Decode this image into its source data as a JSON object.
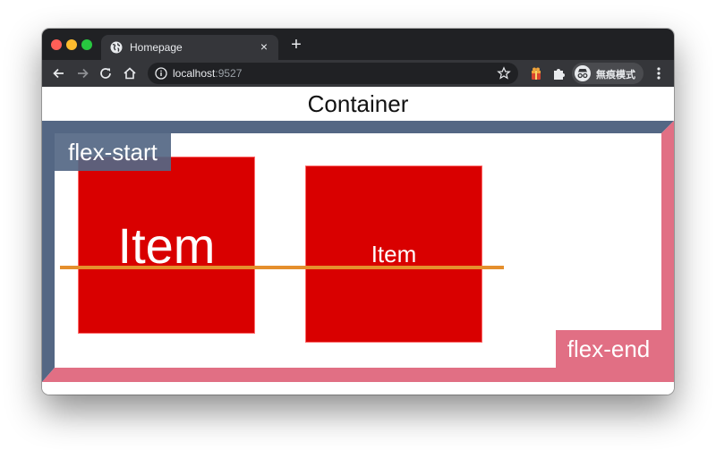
{
  "browser": {
    "tab": {
      "title": "Homepage",
      "close_label": "×",
      "favicon": "globe-icon"
    },
    "new_tab_label": "+",
    "toolbar": {
      "back_icon": "arrow-left-icon",
      "forward_icon": "arrow-right-icon",
      "reload_icon": "reload-icon",
      "home_icon": "home-icon",
      "url_host": "localhost",
      "url_port": ":9527",
      "bookmark_icon": "star-icon",
      "extension_icons": [
        "gift-extension-icon",
        "puzzle-icon"
      ],
      "profile_label": "無痕模式",
      "menu_icon": "kebab-menu-icon"
    }
  },
  "page": {
    "title": "Container",
    "labels": {
      "start": "flex-start",
      "end": "flex-end"
    },
    "items": [
      {
        "label": "Item"
      },
      {
        "label": "Item"
      }
    ]
  },
  "colors": {
    "chrome_dark": "#202124",
    "chrome_toolbar": "#35363a",
    "item_red": "#d90000",
    "start_slate": "#546784",
    "end_pink": "#e16f84",
    "baseline_orange": "#e58f2d"
  }
}
